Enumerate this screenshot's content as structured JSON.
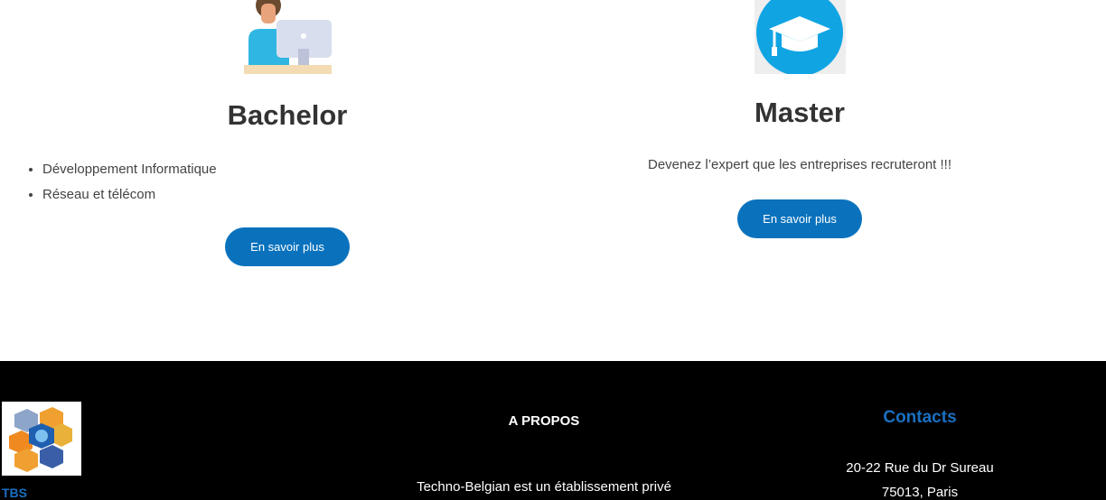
{
  "programs": {
    "bachelor": {
      "title": "Bachelor",
      "items": [
        "Développement Informatique",
        "Réseau et télécom"
      ],
      "button_label": "En savoir plus"
    },
    "master": {
      "title": "Master",
      "description": "Devenez l’expert que les entreprises recruteront !!!",
      "button_label": "En savoir plus"
    }
  },
  "footer": {
    "logo_text": "TBS",
    "about": {
      "heading": "A PROPOS",
      "text": "Techno-Belgian est un établissement privé"
    },
    "contacts": {
      "heading": "Contacts",
      "address_line1": "20-22 Rue du Dr Sureau",
      "address_line2": "75013, Paris"
    }
  },
  "colors": {
    "accent": "#0a72bd",
    "footer_bg": "#000000",
    "link_blue": "#1a6fc0"
  },
  "icons": {
    "bachelor": "student-computer-illustration",
    "master": "graduation-cap-icon"
  }
}
